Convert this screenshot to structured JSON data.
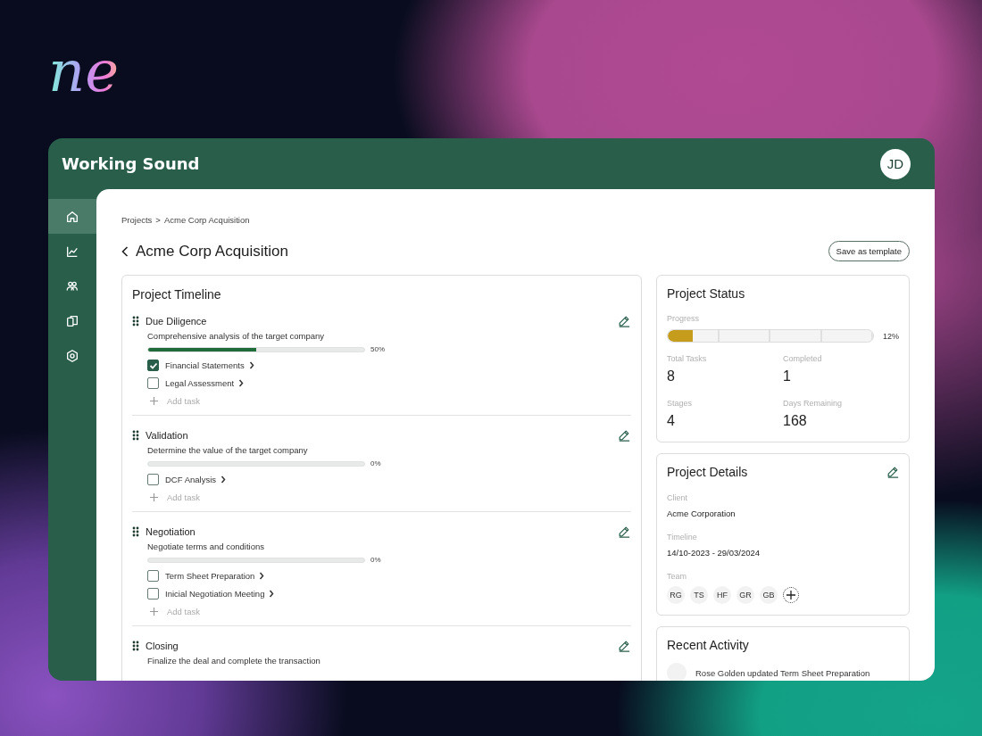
{
  "logo": "ne",
  "app": {
    "title": "Working Sound",
    "avatar": "JD"
  },
  "sidebar": {
    "items": [
      {
        "selected": true
      },
      {
        "selected": false
      },
      {
        "selected": false
      },
      {
        "selected": false
      },
      {
        "selected": false
      }
    ]
  },
  "breadcrumb": {
    "items": [
      "Projects",
      "Acme Corp Acquisition"
    ],
    "separator": ">"
  },
  "page": {
    "title": "Acme Corp Acquisition",
    "save_button": "Save as template"
  },
  "timeline": {
    "title": "Project Timeline",
    "stages": [
      {
        "name": "Due Diligence",
        "description": "Comprehensive analysis of the target company",
        "level": 0.5,
        "percent": "50%",
        "tasks": [
          {
            "label": "Financial Statements",
            "checked": true
          },
          {
            "label": "Legal Assessment",
            "checked": false
          }
        ],
        "add_task": "Add task"
      },
      {
        "name": "Validation",
        "description": "Determine the value of the target company",
        "level": 0,
        "percent": "0%",
        "tasks": [
          {
            "label": "DCF Analysis",
            "checked": false
          }
        ],
        "add_task": "Add task"
      },
      {
        "name": "Negotiation",
        "description": "Negotiate terms and conditions",
        "level": 0,
        "percent": "0%",
        "tasks": [
          {
            "label": "Term Sheet Preparation",
            "checked": false
          },
          {
            "label": "Inicial Negotiation Meeting",
            "checked": false
          }
        ],
        "add_task": "Add task"
      },
      {
        "name": "Closing",
        "description": "Finalize the deal and complete the transaction"
      }
    ]
  },
  "status": {
    "title": "Project Status",
    "progress_label": "Progress",
    "level": 0.12,
    "percent": "12%",
    "stats": [
      {
        "label": "Total Tasks",
        "value": "8"
      },
      {
        "label": "Completed",
        "value": "1"
      },
      {
        "label": "Stages",
        "value": "4"
      },
      {
        "label": "Days Remaining",
        "value": "168"
      }
    ]
  },
  "details": {
    "title": "Project Details",
    "fields": [
      {
        "label": "Client",
        "value": "Acme Corporation"
      },
      {
        "label": "Timeline",
        "value": "14/10-2023 - 29/03/2024"
      }
    ],
    "team_label": "Team",
    "team": [
      "RG",
      "TS",
      "HF",
      "GR",
      "GB"
    ]
  },
  "activity": {
    "title": "Recent Activity",
    "items": [
      {
        "text": "Rose Golden updated Term Sheet Preparation"
      }
    ]
  }
}
